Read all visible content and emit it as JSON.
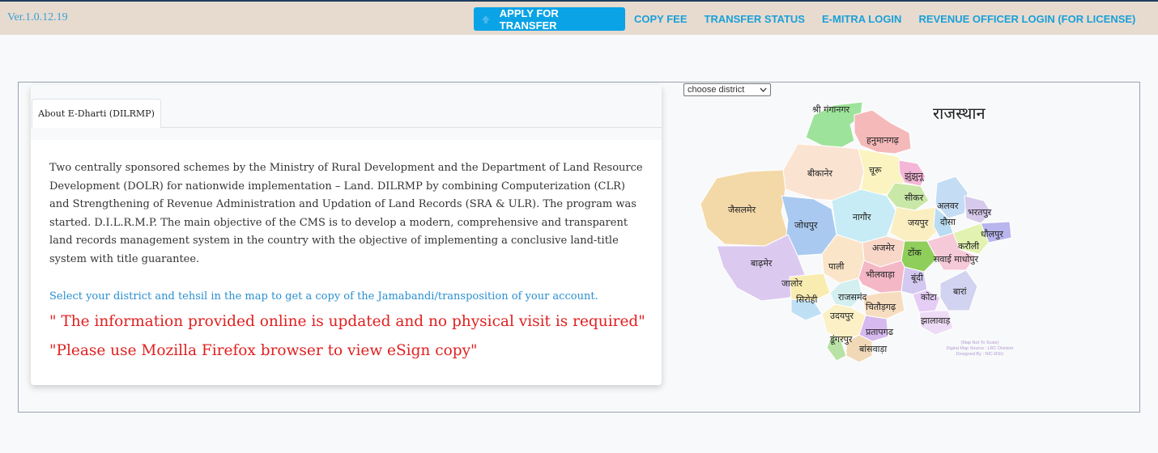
{
  "header": {
    "version": "Ver.1.0.12.19",
    "apply_label": "APPLY FOR TRANSFER",
    "links": [
      "COPY FEE",
      "TRANSFER STATUS",
      "E-MITRA LOGIN",
      "REVENUE OFFICER LOGIN (FOR LICENSE)"
    ]
  },
  "about": {
    "tab_label": "About E-Dharti (DILRMP)",
    "description": "Two centrally sponsored schemes by the Ministry of Rural Development and the Department of Land Resource Development (DOLR) for nationwide implementation – Land. DILRMP by combining Computerization (CLR) and Strengthening of Revenue Administration and Updation of Land Records (SRA & ULR). The program was started. D.I.L.R.M.P. The main objective of the CMS is to develop a modern, comprehensive and transparent land records management system in the country with the objective of implementing a conclusive land-title system with title guarantee.",
    "select_note": "Select your district and tehsil in the map to get a copy of the Jamabandi/transposition of your account.",
    "notice1": "\" The information provided online is updated and no physical visit is required\"",
    "notice2": "\"Please use Mozilla Firefox browser to view eSign copy\""
  },
  "map": {
    "district_select": "choose district",
    "title": "राजस्थान",
    "credit": [
      "(Map Not To Scale)",
      "Digital Map Source : LRC Division",
      "Designed By : NIC-RSU"
    ],
    "districts": {
      "ganganagar": "श्री गंगानगर",
      "hanumangarh": "हनुमानगढ़",
      "bikaner": "बीकानेर",
      "churu": "चूरू",
      "jhunjhunu": "झुंझुनू",
      "sikar": "सीकर",
      "alwar": "अलवर",
      "bharatpur": "भरतपुर",
      "jaisalmer": "जैसलमेर",
      "jodhpur": "जोधपुर",
      "nagaur": "नागौर",
      "jaipur": "जयपुर",
      "dausa": "दौसा",
      "dholpur": "धौलपुर",
      "karauli": "करौली",
      "ajmer": "अजमेर",
      "tonk": "टोंक",
      "sawai_madhopur": "सवाई माधोपुर",
      "barmer": "बाढ़मेर",
      "pali": "पाली",
      "bhilwara": "भीलवाड़ा",
      "bundi": "बूंदी",
      "jalore": "जालोर",
      "sirohi": "सिरोही",
      "rajsamand": "राजसमंद",
      "chittorgarh": "चितौड़गढ़",
      "kota": "कोटा",
      "baran": "बारां",
      "udaipur": "उदयपुर",
      "jhalawar": "झालावाड़",
      "pratapgarh": "प्रतापगढ",
      "dungarpur": "डूंगरपुर",
      "banswara": "बांसवाड़ा"
    },
    "colors": {
      "jaisalmer": "#f3d9a8",
      "barmer": "#dcc9f0",
      "jodhpur": "#a9c9f0",
      "bikaner": "#fbe3d2",
      "ganganagar": "#9ee39b",
      "hanumangarh": "#f5b9b9"
    }
  }
}
